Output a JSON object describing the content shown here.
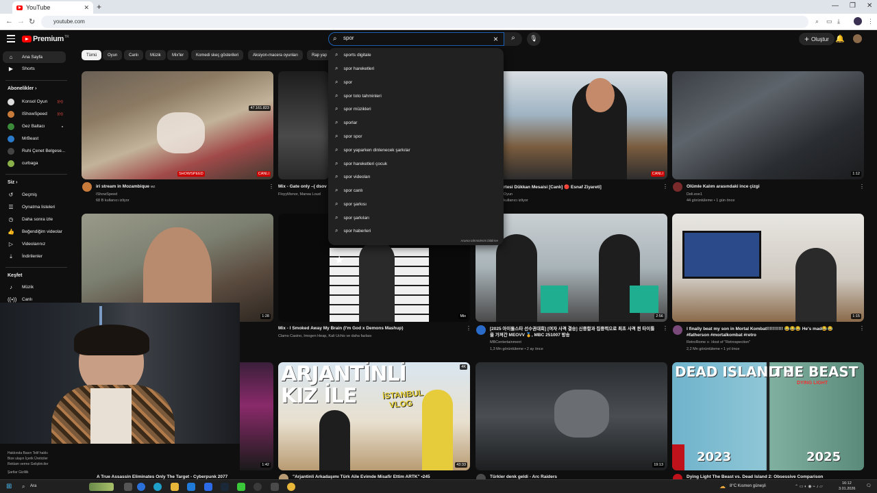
{
  "browser": {
    "tab_title": "YouTube",
    "tab_close": "✕",
    "new_tab": "+",
    "url": "youtube.com",
    "controls": [
      "—",
      "❐",
      "✕"
    ]
  },
  "header": {
    "logo_text": "Premium",
    "logo_sup": "TR",
    "search_value": "spor",
    "create_label": "Oluştur"
  },
  "sidebar": {
    "home": "Ana Sayfa",
    "shorts": "Shorts",
    "subs_heading": "Abonelikler",
    "channels": [
      {
        "name": "Konsol Oyun",
        "live": true
      },
      {
        "name": "IShowSpeed",
        "live": true
      },
      {
        "name": "Gez Baltacı",
        "live": false
      },
      {
        "name": "MrBeast",
        "live": false
      },
      {
        "name": "Ruhi Çenet Belgese...",
        "live": false
      },
      {
        "name": "curbaga",
        "live": false
      }
    ],
    "you_heading": "Siz",
    "you_items": [
      "Geçmiş",
      "Oynatma listeleri",
      "Daha sonra izle",
      "Beğendiğim videolar",
      "Videolarınız",
      "İndirilenler"
    ],
    "explore_heading": "Keşfet",
    "explore_items": [
      "Müzik",
      "Canlı"
    ],
    "footer1": "Hakkında  Basın  Telif hakkı",
    "footer2": "Bize ulaşın  İçerik Üreticiler",
    "footer3": "Reklam verme  Geliştiriciler",
    "footer4": "Şartlar  Gizlilik"
  },
  "chips": [
    "Tümü",
    "Oyun",
    "Canlı",
    "Müzik",
    "Mix'ler",
    "Komedi skeç gösterileri",
    "Aksiyon-macera oyunları",
    "Rap yap"
  ],
  "suggestions": [
    "sports digitale",
    "spor hareketleri",
    "spor",
    "spor toto tahminleri",
    "spor müzikleri",
    "sporlar",
    "spor spor",
    "spor yaparken dinlenecek şarkılar",
    "spor hareketleri çocuk",
    "spor videoları",
    "spor canlı",
    "spor şarkısı",
    "spor şarkıları",
    "spor haberleri"
  ],
  "report_text": "Arama tahminlerini bildirme",
  "videos": [
    {
      "title": "iri stream in Mozambique",
      "sup": "MZ",
      "meta1": "IShowSpeed",
      "meta2": "68 B kullanıcı izliyor",
      "badge": "CANLI",
      "badge2": "47.161.823",
      "live": true
    },
    {
      "title": "Mix - Gate only –( dsov",
      "meta1": "FloyyMenor, Marwa Loud",
      "meta2": "",
      "badge": ""
    },
    {
      "title": "rtesi Dükkan Mesaisi [Canlı] 🔴 Esnaf Ziyareti]",
      "meta1": "Oyun",
      "meta2": "kullanıcı izliyor",
      "badge": "CANLI",
      "live": true
    },
    {
      "title": "Ölümle Kalım arasındaki ince çizgi",
      "meta1": "Deli.exe1",
      "meta2": "44 görüntüleme • 1 gün önce",
      "badge": "1:12"
    },
    {
      "title": "",
      "meta1": "",
      "meta2": "",
      "badge": "1:28"
    },
    {
      "title": "Mix - I Smoked Away My Brain (I'm God x Demons Mashup)",
      "meta1": "Clams Casino, Imogen Heap, Kali Uchis ve daha fazlası",
      "meta2": "",
      "badge": "Mix"
    },
    {
      "title": "[2025 아이돌스타 선수권대회] [여자 사격 결승] 신중함과 집중력으로 최초 사격 퀸 타이틀을 가져간 MEOVV 🏅, MBC 251007 방송",
      "meta1": "MBCentertainment",
      "meta2": "1,3 Mn görüntüleme • 2 ay önce",
      "badge": "2:56"
    },
    {
      "title": "I finally beat my son in Mortal Kombat!!!!!!!!!!! 😂😂😂 He's mad😂😂 #fatherson #mortalkombat #retro",
      "meta1": "RetroRome ≡· Host of \"Retrospection\"",
      "meta2": "2,2 Mn görüntüleme • 1 yıl önce",
      "badge": "1:15"
    },
    {
      "title": "A True Assassin Eliminates Only The Target - Cyberpunk 2077",
      "meta1": "",
      "meta2": "",
      "badge": "1:42"
    },
    {
      "title": "\"Arjantinli Arkadaşımı Türk Aile Evimde Misafir Ettim ARTK\" •245",
      "meta1": "",
      "meta2": "",
      "badge": "43:33",
      "badge_top": "4K",
      "thumb_line1": "ARJANTİNLİ",
      "thumb_line2": "KIZ İLE",
      "thumb_tag1": "İSTANBUL",
      "thumb_tag2": "VLOG"
    },
    {
      "title": "Türkler denk geldi - Arc Raiders",
      "meta1": "",
      "meta2": "",
      "badge": "19:13"
    },
    {
      "title": "Dying Light The Beast vs. Dead Island 2: Obsessive Comparison",
      "meta1": "",
      "meta2": "",
      "badge": "",
      "thumb_l": "DEAD ISLAND 2",
      "thumb_r": "THE BEAST",
      "thumb_r_sub": "DYING LIGHT",
      "year_l": "2023",
      "year_r": "2025"
    }
  ],
  "taskbar": {
    "search": "Ara",
    "weather": "8°C  Kısmen güneşli",
    "time": "16:12",
    "date": "3.01.2026"
  }
}
